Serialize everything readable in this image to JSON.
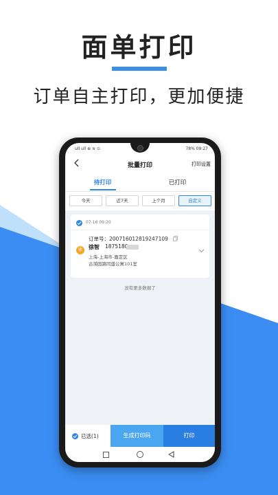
{
  "promo": {
    "title": "面单打印",
    "subtitle": "订单自主打印，更加便捷"
  },
  "status_bar": {
    "left": "ull ull ⊕ ≋ ⊙",
    "battery": "78%",
    "time": "09:27"
  },
  "nav": {
    "title": "批量打印",
    "action": "打印设置"
  },
  "tabs": [
    {
      "label": "待打印",
      "active": true
    },
    {
      "label": "已打印",
      "active": false
    }
  ],
  "filters": [
    {
      "label": "今天",
      "active": false
    },
    {
      "label": "近7天",
      "active": false
    },
    {
      "label": "上个月",
      "active": false
    },
    {
      "label": "自定义",
      "active": true
    }
  ],
  "order": {
    "date": "07-16 09:20",
    "order_label": "订单号：",
    "order_no": "200716012819247109",
    "badge": "收",
    "name": "徐智",
    "phone": "1875180",
    "address_line1": "上海-上海市-嘉定区",
    "address_line2": "古漪园路同盛公寓101室"
  },
  "list_footer": "没有更多数据了",
  "bottom": {
    "selected": "已选(1)",
    "generate": "生成打印码",
    "print": "打印"
  },
  "colors": {
    "primary": "#2f86e8",
    "bg_dark_blue": "#3b8df3",
    "bg_light_blue": "#bfe0fb",
    "badge_orange": "#f5a623"
  }
}
